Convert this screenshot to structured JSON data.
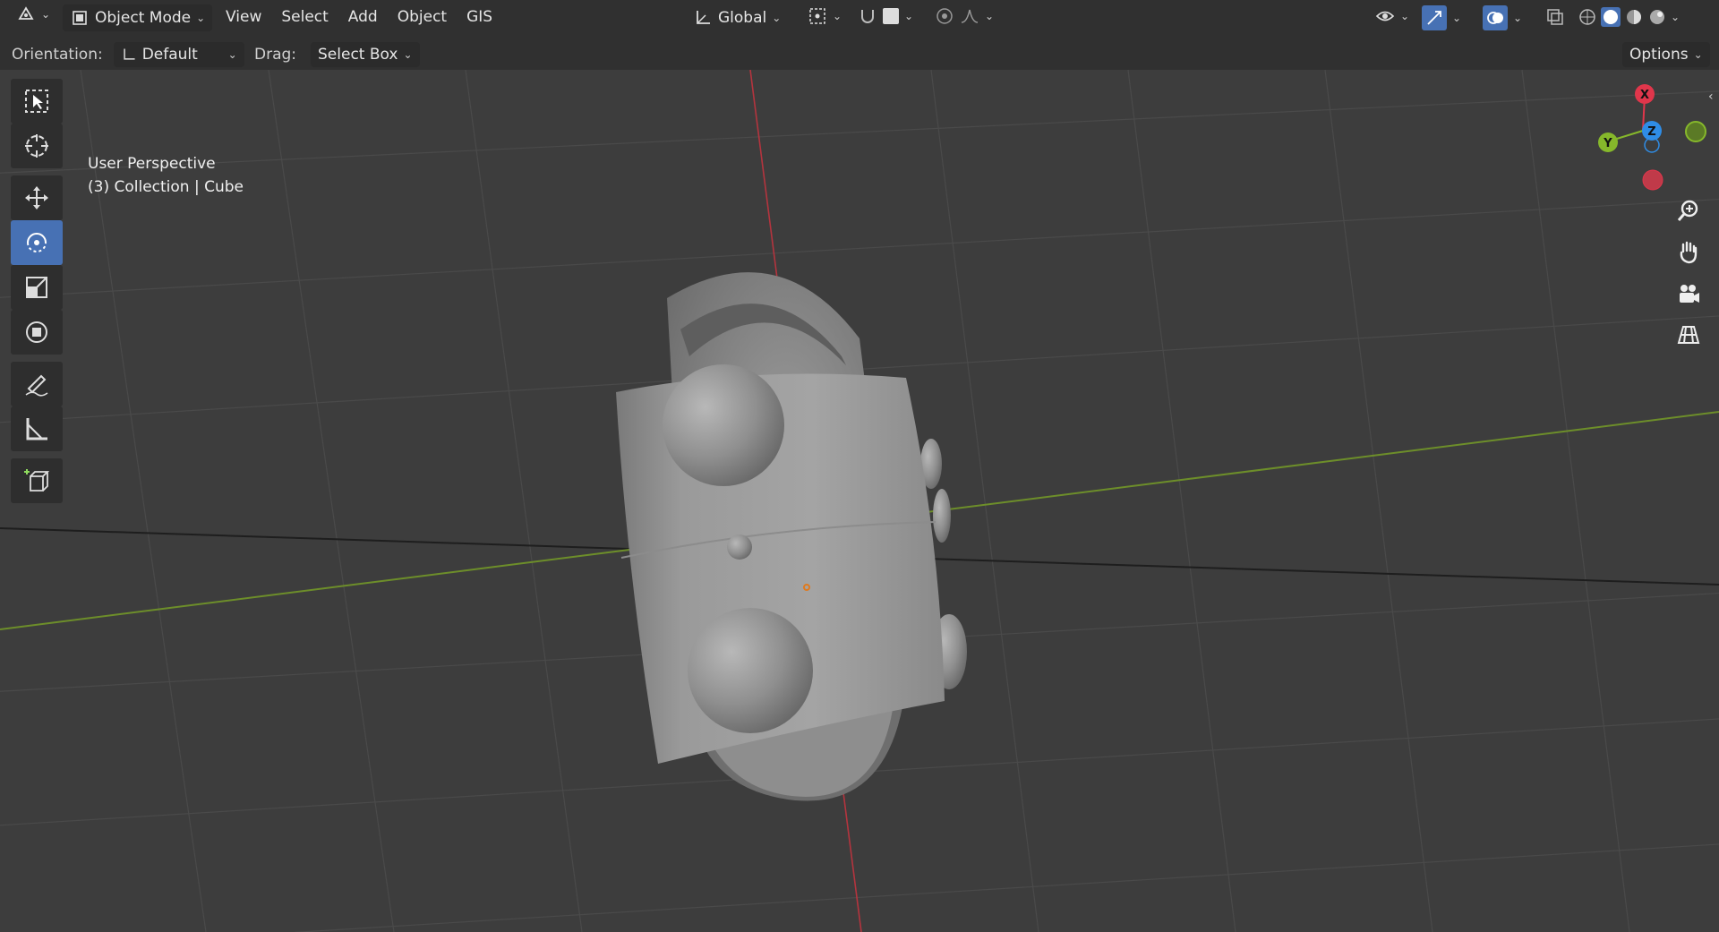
{
  "header": {
    "mode_label": "Object Mode",
    "menus": [
      "View",
      "Select",
      "Add",
      "Object",
      "GIS"
    ],
    "transform_orientation": "Global"
  },
  "tool_header": {
    "orientation_label": "Orientation:",
    "orientation_value": "Default",
    "drag_label": "Drag:",
    "drag_value": "Select Box",
    "options_label": "Options"
  },
  "viewport": {
    "view_name": "User Perspective",
    "context": "(3) Collection | Cube"
  },
  "gizmo": {
    "x_label": "X",
    "y_label": "Y",
    "z_label": "Z",
    "colors": {
      "x": "#e0364b",
      "y": "#86b82b",
      "z": "#2f8de6"
    }
  },
  "toolbar": {
    "active_tool": "rotate-tool"
  },
  "icons": {
    "editor_type": "editor-type-icon",
    "mode": "object-mode-icon",
    "transform": "transform-orientation-icon",
    "pivot": "pivot-point-icon",
    "snap": "snap-magnet-icon",
    "proportional": "proportional-edit-icon",
    "visibility": "eye-visibility-icon",
    "gizmo_toggle": "gizmo-toggle-icon",
    "overlay": "overlay-icon",
    "xray": "xray-icon",
    "shading": [
      "wireframe-shading-icon",
      "solid-shading-icon",
      "material-shading-icon",
      "rendered-shading-icon"
    ],
    "nav": [
      "zoom-icon",
      "pan-hand-icon",
      "camera-view-icon",
      "ortho-grid-icon"
    ]
  },
  "accent_color": "#4771b4"
}
